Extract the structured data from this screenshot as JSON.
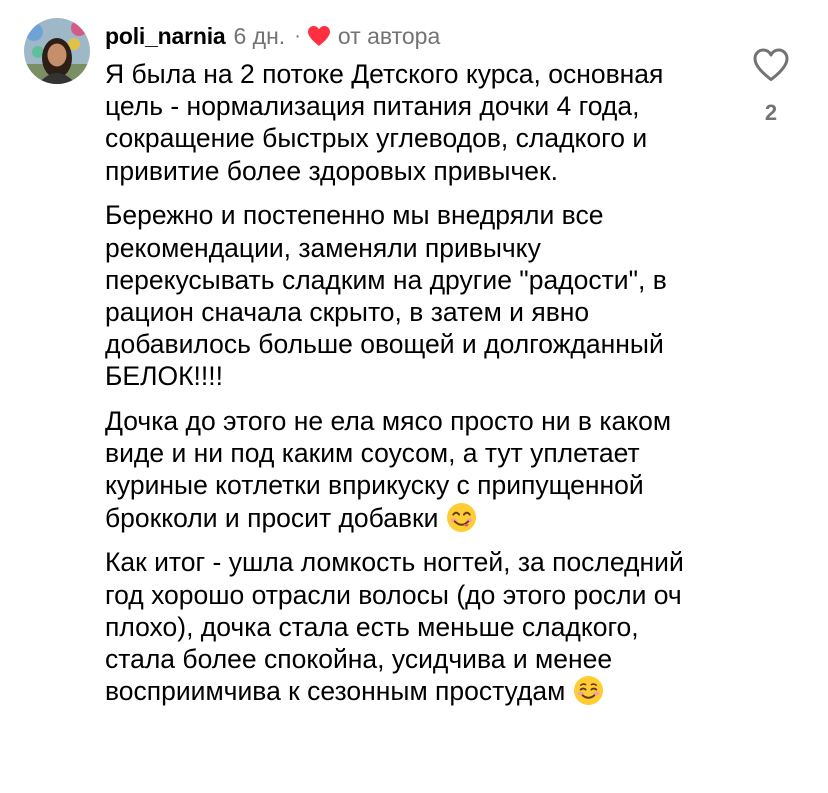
{
  "comment": {
    "username": "poli_narnia",
    "time_ago": "6 дн.",
    "separator": "·",
    "author_label": "от автора",
    "paragraphs": [
      "Я была на 2 потоке Детского курса, основная цель - нормализация питания дочки 4 года, сокращение быстрых углеводов, сладкого и привитие более здоровых привычек.",
      "Бережно и постепенно мы внедряли все рекомендации, заменяли привычку перекусывать сладким на другие \"радости\", в рацион сначала скрыто, в затем и явно добавилось больше овощей и долгожданный БЕЛОК!!!!",
      "Дочка до этого не ела мясо просто ни в каком виде и ни под каким соусом, а тут уплетает куриные котлетки вприкуску с припущенной брокколи и просит добавки",
      "Как итог - ушла ломкость ногтей, за последний год хорошо отрасли волосы (до этого росли оч плохо), дочка стала есть меньше сладкого, стала более спокойна, усидчива и менее восприимчива к сезонным простудам"
    ],
    "emojis": [
      "yummy-face-emoji",
      "smiling-face-emoji"
    ],
    "like_count": "2"
  },
  "colors": {
    "text": "#000000",
    "secondary": "#737373",
    "heart_red": "#ff3040"
  },
  "icons": {
    "avatar": "user-avatar",
    "author_like": "heart-filled-icon",
    "like_button": "heart-outline-icon"
  }
}
